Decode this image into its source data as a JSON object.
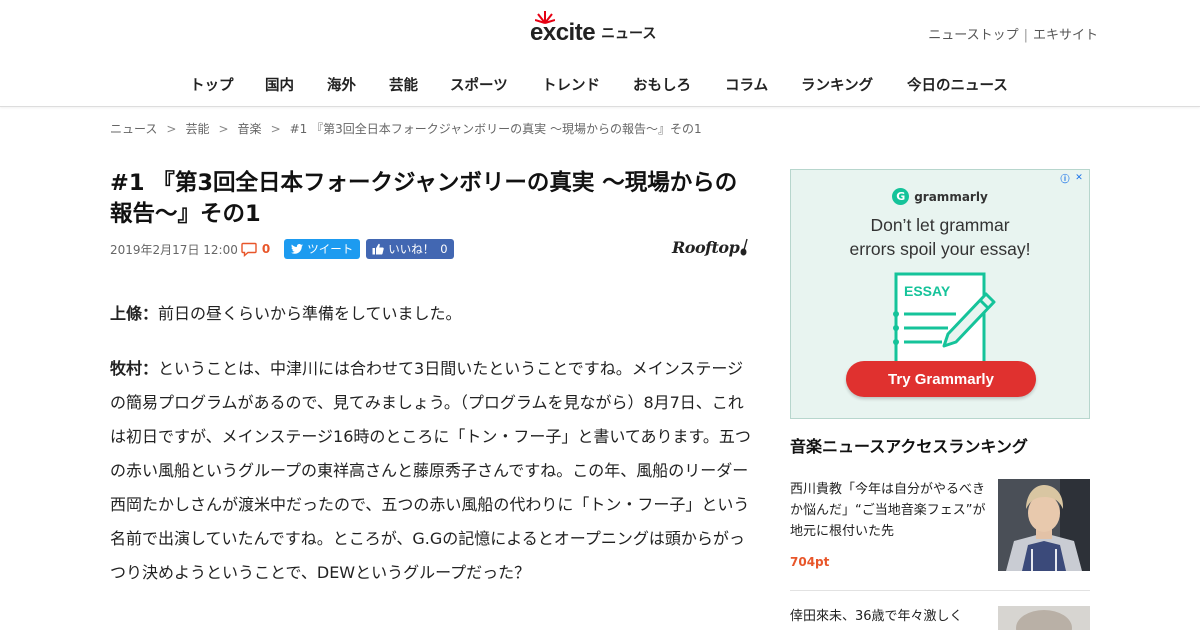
{
  "header": {
    "logo_text": "excite",
    "logo_sub": "ニュース",
    "top_links": [
      "ニューストップ",
      "エキサイト"
    ],
    "nav": [
      "トップ",
      "国内",
      "海外",
      "芸能",
      "スポーツ",
      "トレンド",
      "おもしろ",
      "コラム",
      "ランキング",
      "今日のニュース"
    ]
  },
  "breadcrumb": [
    "ニュース",
    "芸能",
    "音楽",
    "#1 『第3回全日本フォークジャンボリーの真実 〜現場からの報告〜』その1"
  ],
  "article": {
    "title": "#1 『第3回全日本フォークジャンボリーの真実 〜現場からの報告〜』その1",
    "date": "2019年2月17日 12:00",
    "comment_count": "0",
    "tweet_label": "ツイート",
    "like_label": "いいね！",
    "like_count": "0",
    "source": "Rooftop",
    "paragraphs": [
      {
        "speaker": "上條：",
        "text": "前日の昼くらいから準備をしていました。"
      },
      {
        "speaker": "牧村：",
        "text": "ということは、中津川には合わせて3日間いたということですね。メインステージの簡易プログラムがあるので、見てみましょう。（プログラムを見ながら）8月7日、これは初日ですが、メインステージ16時のところに「トン・フー子」と書いてあります。五つの赤い風船というグループの東祥高さんと藤原秀子さんですね。この年、風船のリーダー西岡たかしさんが渡米中だったので、五つの赤い風船の代わりに「トン・フー子」という名前で出演していたんですね。ところが、G.Gの記憶によるとオープニングは頭からがっつり決めようということで、DEWというグループだった？"
      }
    ]
  },
  "ad": {
    "brand": "grammarly",
    "headline_1": "Don’t let grammar",
    "headline_2": "errors spoil your essay!",
    "illustration_label": "ESSAY",
    "cta": "Try Grammarly",
    "accent": "#15c39a",
    "cta_color": "#e0312f"
  },
  "ranking": {
    "title": "音楽ニュースアクセスランキング",
    "items": [
      {
        "text": "西川貴教「今年は自分がやるべきか悩んだ」“ご当地音楽フェス”が地元に根付いた先",
        "points": "704pt"
      },
      {
        "text": "倖田來未、36歳で年々激しく"
      }
    ]
  }
}
